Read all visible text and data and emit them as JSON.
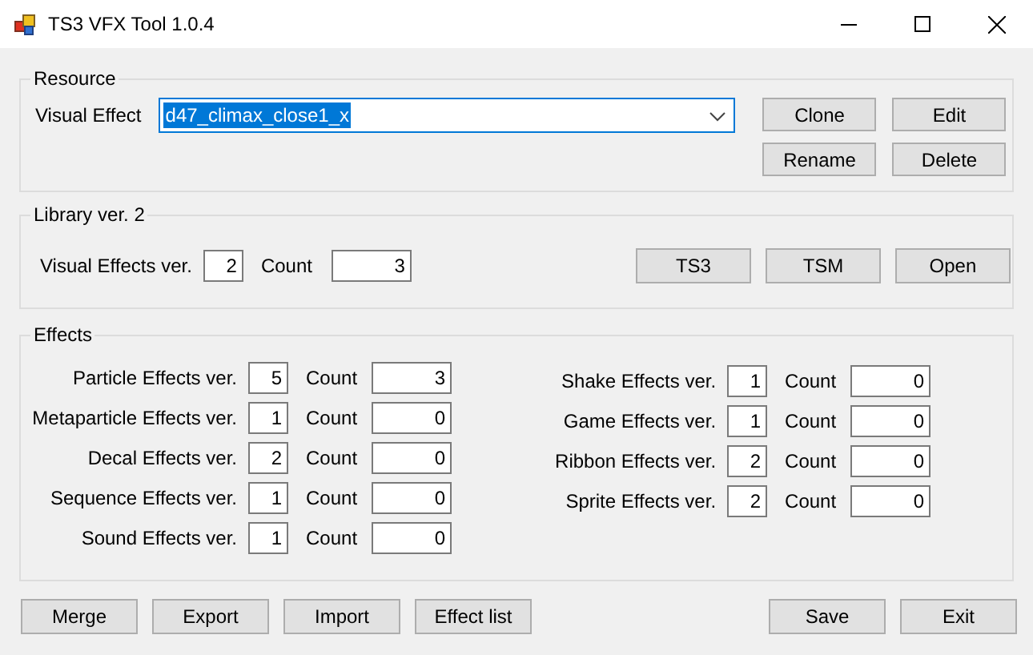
{
  "window": {
    "title": "TS3 VFX Tool 1.0.4"
  },
  "resource": {
    "title": "Resource",
    "label": "Visual Effect",
    "value": "d47_climax_close1_x",
    "value_selected": true,
    "buttons": [
      "Clone",
      "Edit",
      "Rename",
      "Delete"
    ]
  },
  "library": {
    "title": "Library ver. 2",
    "version_label": "Visual Effects ver.",
    "version": "2",
    "count_label": "Count",
    "count": "3",
    "buttons": [
      "TS3",
      "TSM",
      "Open"
    ]
  },
  "effects": {
    "title": "Effects",
    "columns": [
      [
        {
          "label": "Particle Effects ver.",
          "version": "5",
          "count_label": "Count",
          "count": "3"
        },
        {
          "label": "Metaparticle Effects ver.",
          "version": "1",
          "count_label": "Count",
          "count": "0"
        },
        {
          "label": "Decal Effects ver.",
          "version": "2",
          "count_label": "Count",
          "count": "0"
        },
        {
          "label": "Sequence Effects ver.",
          "version": "1",
          "count_label": "Count",
          "count": "0"
        },
        {
          "label": "Sound Effects ver.",
          "version": "1",
          "count_label": "Count",
          "count": "0"
        }
      ],
      [
        {
          "label": "Shake Effects ver.",
          "version": "1",
          "count_label": "Count",
          "count": "0"
        },
        {
          "label": "Game Effects ver.",
          "version": "1",
          "count_label": "Count",
          "count": "0"
        },
        {
          "label": "Ribbon Effects ver.",
          "version": "2",
          "count_label": "Count",
          "count": "0"
        },
        {
          "label": "Sprite Effects ver.",
          "version": "2",
          "count_label": "Count",
          "count": "0"
        }
      ]
    ]
  },
  "buttons_left": [
    "Merge",
    "Export",
    "Import",
    "Effect list"
  ],
  "buttons_right": [
    "Save",
    "Exit"
  ]
}
